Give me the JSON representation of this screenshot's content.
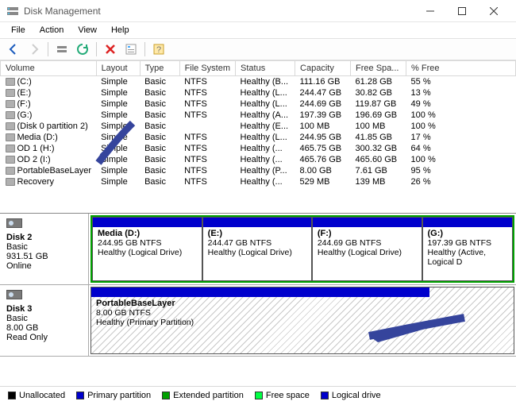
{
  "window": {
    "title": "Disk Management"
  },
  "menu": [
    "File",
    "Action",
    "View",
    "Help"
  ],
  "columns": [
    "Volume",
    "Layout",
    "Type",
    "File System",
    "Status",
    "Capacity",
    "Free Spa...",
    "% Free"
  ],
  "volumes": [
    {
      "name": "(C:)",
      "layout": "Simple",
      "type": "Basic",
      "fs": "NTFS",
      "status": "Healthy (B...",
      "capacity": "111.16 GB",
      "free": "61.28 GB",
      "pct": "55 %"
    },
    {
      "name": "(E:)",
      "layout": "Simple",
      "type": "Basic",
      "fs": "NTFS",
      "status": "Healthy (L...",
      "capacity": "244.47 GB",
      "free": "30.82 GB",
      "pct": "13 %"
    },
    {
      "name": "(F:)",
      "layout": "Simple",
      "type": "Basic",
      "fs": "NTFS",
      "status": "Healthy (L...",
      "capacity": "244.69 GB",
      "free": "119.87 GB",
      "pct": "49 %"
    },
    {
      "name": "(G:)",
      "layout": "Simple",
      "type": "Basic",
      "fs": "NTFS",
      "status": "Healthy (A...",
      "capacity": "197.39 GB",
      "free": "196.69 GB",
      "pct": "100 %"
    },
    {
      "name": "(Disk 0 partition 2)",
      "layout": "Simple",
      "type": "Basic",
      "fs": "",
      "status": "Healthy (E...",
      "capacity": "100 MB",
      "free": "100 MB",
      "pct": "100 %"
    },
    {
      "name": "Media (D:)",
      "layout": "Simple",
      "type": "Basic",
      "fs": "NTFS",
      "status": "Healthy (L...",
      "capacity": "244.95 GB",
      "free": "41.85 GB",
      "pct": "17 %"
    },
    {
      "name": "OD 1 (H:)",
      "layout": "Simple",
      "type": "Basic",
      "fs": "NTFS",
      "status": "Healthy (...",
      "capacity": "465.75 GB",
      "free": "300.32 GB",
      "pct": "64 %"
    },
    {
      "name": "OD 2 (I:)",
      "layout": "Simple",
      "type": "Basic",
      "fs": "NTFS",
      "status": "Healthy (...",
      "capacity": "465.76 GB",
      "free": "465.60 GB",
      "pct": "100 %"
    },
    {
      "name": "PortableBaseLayer",
      "layout": "Simple",
      "type": "Basic",
      "fs": "NTFS",
      "status": "Healthy (P...",
      "capacity": "8.00 GB",
      "free": "7.61 GB",
      "pct": "95 %"
    },
    {
      "name": "Recovery",
      "layout": "Simple",
      "type": "Basic",
      "fs": "NTFS",
      "status": "Healthy (...",
      "capacity": "529 MB",
      "free": "139 MB",
      "pct": "26 %"
    }
  ],
  "disks": {
    "disk2": {
      "label": "Disk 2",
      "type": "Basic",
      "size": "931.51 GB",
      "status": "Online",
      "partitions": [
        {
          "name": "Media  (D:)",
          "size": "244.95 GB NTFS",
          "stat": "Healthy (Logical Drive)"
        },
        {
          "name": "(E:)",
          "size": "244.47 GB NTFS",
          "stat": "Healthy (Logical Drive)"
        },
        {
          "name": "(F:)",
          "size": "244.69 GB NTFS",
          "stat": "Healthy (Logical Drive)"
        },
        {
          "name": "(G:)",
          "size": "197.39 GB NTFS",
          "stat": "Healthy (Active, Logical D"
        }
      ]
    },
    "disk3": {
      "label": "Disk 3",
      "type": "Basic",
      "size": "8.00 GB",
      "status": "Read Only",
      "partition": {
        "name": "PortableBaseLayer",
        "size": "8.00 GB NTFS",
        "stat": "Healthy (Primary Partition)"
      }
    }
  },
  "legend": {
    "unallocated": "Unallocated",
    "primary": "Primary partition",
    "extended": "Extended partition",
    "free": "Free space",
    "logical": "Logical drive"
  }
}
